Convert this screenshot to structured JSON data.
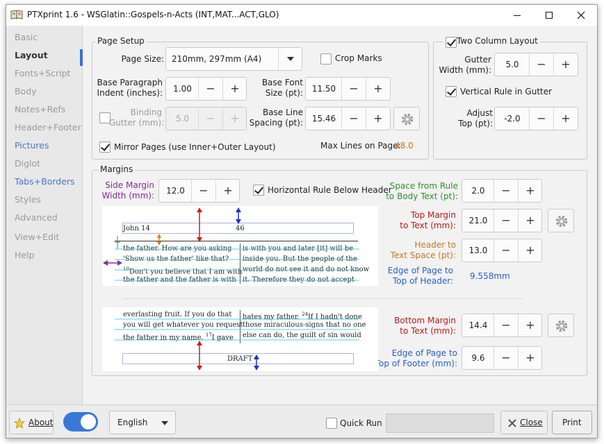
{
  "window": {
    "title": "PTXprint 1.6  -  WSGlatin::Gospels-n-Acts  (INT,MAT...ACT,GLO)",
    "icon": "book-icon"
  },
  "sidebar": {
    "items": [
      {
        "label": "Basic"
      },
      {
        "label": "Layout"
      },
      {
        "label": "Fonts+Script"
      },
      {
        "label": "Body"
      },
      {
        "label": "Notes+Refs"
      },
      {
        "label": "Header+Footer"
      },
      {
        "label": "Pictures"
      },
      {
        "label": "Diglot"
      },
      {
        "label": "Tabs+Borders"
      },
      {
        "label": "Styles"
      },
      {
        "label": "Advanced"
      },
      {
        "label": "View+Edit"
      },
      {
        "label": "Help"
      }
    ],
    "active": "Layout"
  },
  "page_setup": {
    "title": "Page Setup",
    "page_size_label": "Page Size:",
    "page_size_value": "210mm, 297mm (A4)",
    "crop_marks_label": "Crop Marks",
    "crop_marks_checked": false,
    "indent_label_1": "Base Paragraph",
    "indent_label_2": "Indent (inches):",
    "indent_value": "1.00",
    "font_size_label_1": "Base Font",
    "font_size_label_2": "Size (pt):",
    "font_size_value": "11.50",
    "binding_label_1": "Binding",
    "binding_label_2": "Gutter (mm):",
    "binding_checked": false,
    "binding_value": "5.0",
    "line_spacing_label_1": "Base Line",
    "line_spacing_label_2": "Spacing (pt):",
    "line_spacing_value": "15.46",
    "mirror_label": "Mirror Pages (use Inner+Outer Layout)",
    "mirror_checked": true,
    "max_lines_label": "Max Lines on Page:",
    "max_lines_value": "48.0",
    "max_lines_color": "#c07a20"
  },
  "two_column": {
    "title": "Two Column Layout",
    "checked": true,
    "gutter_label_1": "Gutter",
    "gutter_label_2": "Width (mm):",
    "gutter_value": "5.0",
    "vrule_label": "Vertical Rule in Gutter",
    "vrule_checked": true,
    "adjust_label_1": "Adjust",
    "adjust_label_2": "Top (pt):",
    "adjust_value": "-2.0"
  },
  "margins": {
    "title": "Margins",
    "side_margin_label_1": "Side Margin",
    "side_margin_label_2": "Width (mm):",
    "side_margin_value": "12.0",
    "side_margin_color": "#8a2a9a",
    "hrule_label": "Horizontal Rule Below Header",
    "hrule_checked": true,
    "space_rule_label_1": "Space from Rule",
    "space_rule_label_2": "to Body Text (pt):",
    "space_rule_value": "2.0",
    "space_rule_color": "#2f8f2f",
    "top_margin_label_1": "Top Margin",
    "top_margin_label_2": "to Text (mm):",
    "top_margin_value": "21.0",
    "top_margin_color": "#c01818",
    "header_space_label_1": "Header to",
    "header_space_label_2": "Text Space (pt):",
    "header_space_value": "13.0",
    "header_space_color": "#c07a20",
    "edge_header_label_1": "Edge of Page to",
    "edge_header_label_2": "Top of Header:",
    "edge_header_value": "9.558mm",
    "edge_header_color": "#2a5fc4",
    "bottom_margin_label_1": "Bottom Margin",
    "bottom_margin_label_2": "to Text (mm):",
    "bottom_margin_value": "14.4",
    "edge_footer_label_1": "Edge of Page to",
    "edge_footer_label_2": "Top of Footer (mm):",
    "edge_footer_value": "9.6"
  },
  "preview": {
    "header_left": "John 14",
    "header_page": "46",
    "top_col1": [
      "the father. How are you asking",
      "'Show us the father' like that?",
      "Don't you believe that I am with",
      "the father and the father is with"
    ],
    "top_col1_verse": "10",
    "top_col2": [
      "is with you and later [it] will be",
      "inside you. But the people of the",
      "world do not see it and do not know",
      "it. Therefore they do not accept"
    ],
    "bottom_col1": [
      "everlasting fruit. If you do that",
      "you will get whatever you request",
      "the father in my name."
    ],
    "bottom_col1_tail": "I gave",
    "bottom_col1_verse": "17",
    "bottom_col2": [
      "hates my father.",
      "those miraculous-signs that no one",
      "else can do, the guilt of sin would"
    ],
    "bottom_col2_tail": "If I hadn't done",
    "bottom_col2_verse": "24",
    "footer_text": "DRAFT"
  },
  "bottom_bar": {
    "about_label": "About",
    "toggle_on": true,
    "language_value": "English",
    "quick_run_label": "Quick Run",
    "quick_run_checked": false,
    "close_label": "Close",
    "print_label": "Print"
  }
}
